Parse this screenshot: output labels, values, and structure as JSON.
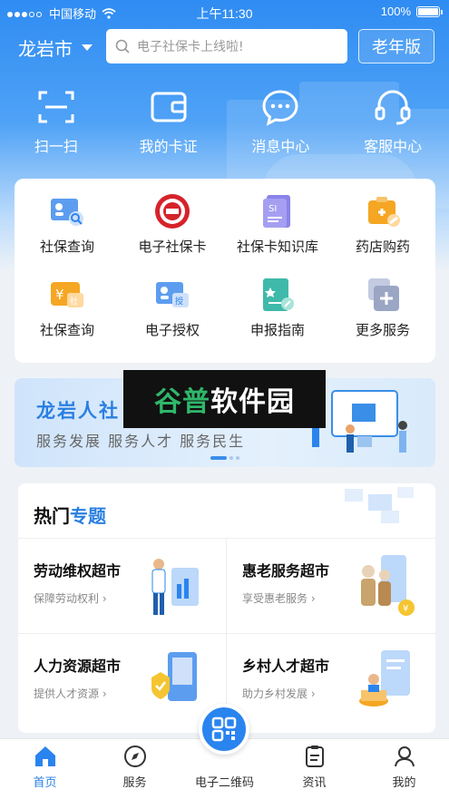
{
  "status_bar": {
    "carrier": "中国移动",
    "time": "上午11:30",
    "battery": "100%"
  },
  "header": {
    "city": "龙岩市",
    "search_placeholder": "电子社保卡上线啦!",
    "elder_mode": "老年版"
  },
  "quick_actions": [
    {
      "label": "扫一扫",
      "icon": "scan-icon"
    },
    {
      "label": "我的卡证",
      "icon": "wallet-icon"
    },
    {
      "label": "消息中心",
      "icon": "message-icon"
    },
    {
      "label": "客服中心",
      "icon": "headset-icon"
    }
  ],
  "services": [
    {
      "label": "社保查询",
      "icon": "id-card-search-icon"
    },
    {
      "label": "电子社保卡",
      "icon": "social-security-emblem-icon"
    },
    {
      "label": "社保卡知识库",
      "icon": "si-book-icon"
    },
    {
      "label": "药店购药",
      "icon": "medicine-icon"
    },
    {
      "label": "社保查询",
      "icon": "yuan-social-icon"
    },
    {
      "label": "电子授权",
      "icon": "authorize-icon"
    },
    {
      "label": "申报指南",
      "icon": "guide-icon"
    },
    {
      "label": "更多服务",
      "icon": "more-icon"
    }
  ],
  "banner": {
    "title": "龙岩人社",
    "subtitle": "服务发展  服务人才  服务民生",
    "pages": 3,
    "active_page": 1
  },
  "watermark": {
    "text_a": "谷普",
    "text_b": "软件园"
  },
  "topics": {
    "title_a": "热门",
    "title_b": "专题",
    "items": [
      {
        "title": "劳动维权超市",
        "subtitle": "保障劳动权利"
      },
      {
        "title": "惠老服务超市",
        "subtitle": "享受惠老服务"
      },
      {
        "title": "人力资源超市",
        "subtitle": "提供人才资源"
      },
      {
        "title": "乡村人才超市",
        "subtitle": "助力乡村发展"
      }
    ]
  },
  "tabbar": [
    {
      "label": "首页",
      "active": true
    },
    {
      "label": "服务",
      "active": false
    },
    {
      "label": "电子二维码",
      "active": false
    },
    {
      "label": "资讯",
      "active": false
    },
    {
      "label": "我的",
      "active": false
    }
  ],
  "colors": {
    "primary": "#2a84ef",
    "accent_orange": "#f5a623",
    "text": "#222222"
  }
}
